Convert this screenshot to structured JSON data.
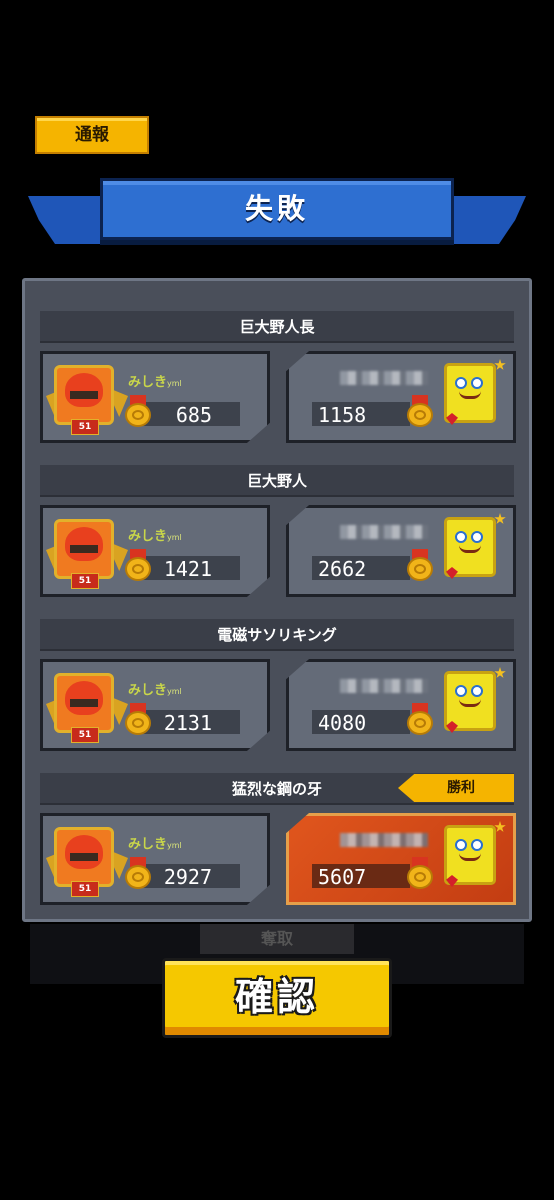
{
  "header": {
    "report_label": "通報"
  },
  "result_banner": {
    "title": "失敗"
  },
  "rounds": [
    {
      "name": "巨大野人長",
      "player": {
        "name": "みしき",
        "name_suffix": "yml",
        "level": "51",
        "power": "685"
      },
      "opponent": {
        "power": "1158"
      },
      "winner": "opponent"
    },
    {
      "name": "巨大野人",
      "player": {
        "name": "みしき",
        "name_suffix": "yml",
        "level": "51",
        "power": "1421"
      },
      "opponent": {
        "power": "2662"
      },
      "winner": "opponent"
    },
    {
      "name": "電磁サソリキング",
      "player": {
        "name": "みしき",
        "name_suffix": "yml",
        "level": "51",
        "power": "2131"
      },
      "opponent": {
        "power": "4080"
      },
      "winner": "opponent"
    },
    {
      "name": "猛烈な鋼の牙",
      "player": {
        "name": "みしき",
        "name_suffix": "yml",
        "level": "51",
        "power": "2927"
      },
      "opponent": {
        "power": "5607"
      },
      "winner": "opponent",
      "badge": "勝利"
    }
  ],
  "below_panel": {
    "label": "奪取"
  },
  "footer": {
    "confirm_label": "確認"
  },
  "colors": {
    "accent_gold": "#f5c800",
    "banner_blue": "#2e6fd1",
    "panel_bg": "#4a4f5a",
    "winner_card": "#e0561d"
  },
  "icons": [
    "crown-icon",
    "medal-icon",
    "gem-icon",
    "star-icon"
  ]
}
